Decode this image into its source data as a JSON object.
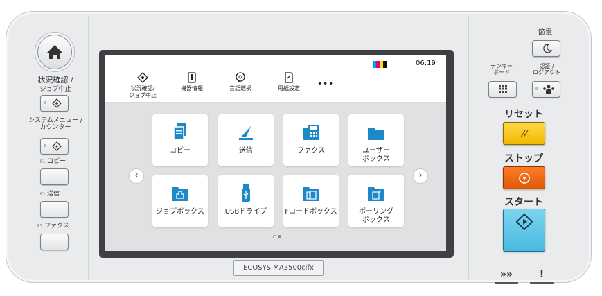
{
  "left_panel": {
    "status_label": "状況確認 /",
    "status_label2": "ジョブ中止",
    "system_label": "システムメニュー /",
    "system_label2": "カウンター",
    "f1_label": "コピー",
    "f1_prefix": "F1",
    "f2_label": "送信",
    "f2_prefix": "F2",
    "f3_label": "ファクス",
    "f3_prefix": "F3"
  },
  "screen": {
    "time": "06:19",
    "toolbar": [
      {
        "label": "状況確認/",
        "label2": "ジョブ中止",
        "icon": "status-icon"
      },
      {
        "label": "機器情報",
        "label2": "",
        "icon": "device-info-icon"
      },
      {
        "label": "言語選択",
        "label2": "",
        "icon": "language-icon"
      },
      {
        "label": "用紙設定",
        "label2": "",
        "icon": "paper-icon"
      }
    ],
    "more": "•••",
    "tiles": [
      {
        "label": "コピー",
        "label2": "",
        "icon": "copy-icon"
      },
      {
        "label": "送信",
        "label2": "",
        "icon": "send-icon"
      },
      {
        "label": "ファクス",
        "label2": "",
        "icon": "fax-icon"
      },
      {
        "label": "ユーザー",
        "label2": "ボックス",
        "icon": "user-box-icon"
      },
      {
        "label": "ジョブボックス",
        "label2": "",
        "icon": "job-box-icon"
      },
      {
        "label": "USBドライブ",
        "label2": "",
        "icon": "usb-icon"
      },
      {
        "label": "Fコードボックス",
        "label2": "",
        "icon": "fcode-box-icon"
      },
      {
        "label": "ポーリング",
        "label2": "ボックス",
        "icon": "polling-box-icon"
      }
    ],
    "prev": "‹",
    "next": "›"
  },
  "model_label": "ECOSYS MA3500cifx",
  "right_panel": {
    "energy_label": "節電",
    "keypad_label": "テンキー",
    "keypad_label2": "ボード",
    "auth_label": "認証 /",
    "auth_label2": "ログアウト",
    "reset_label": "リセット",
    "stop_label": "ストップ",
    "start_label": "スタート",
    "processing_indicator": "»»",
    "attention_indicator": "!"
  },
  "colors": {
    "reset": "#f5c400",
    "stop": "#e8650f",
    "start": "#5ec6e8",
    "toner": [
      "#00a0e9",
      "#e4007f",
      "#ffe100",
      "#111111"
    ]
  }
}
